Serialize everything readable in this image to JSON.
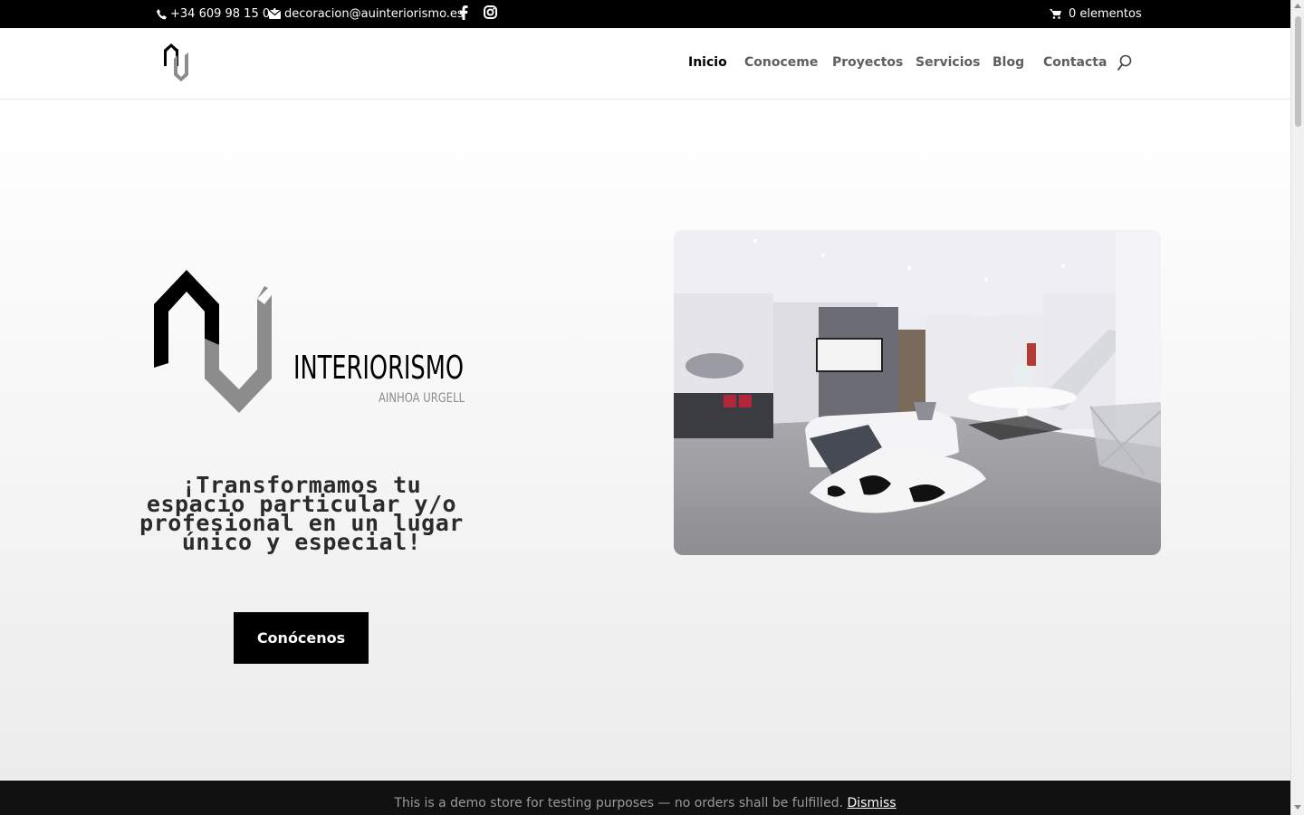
{
  "topbar": {
    "phone": "+34 609 98 15 04",
    "email": "decoracion@auinteriorismo.es",
    "cart": "0 elementos"
  },
  "nav": {
    "items": [
      "Inicio",
      "Conoceme",
      "Proyectos",
      "Servicios",
      "Blog",
      "Contacta"
    ],
    "active": "Inicio"
  },
  "hero": {
    "logo_word": "INTERIORISMO",
    "logo_sub": "AINHOA URGELL",
    "tagline": "¡Transformamos tu espacio particular y/o profesional en un lugar único y especial!",
    "cta_label": "Conócenos"
  },
  "notice": {
    "text": "This is a demo store for testing purposes — no orders shall be fulfilled.",
    "dismiss": "Dismiss"
  },
  "colors": {
    "topbar_bg": "#000000",
    "nav_text": "#5e5e5e",
    "nav_active": "#000000",
    "cta_bg": "#000000",
    "logo_gray": "#8c8c8c"
  }
}
